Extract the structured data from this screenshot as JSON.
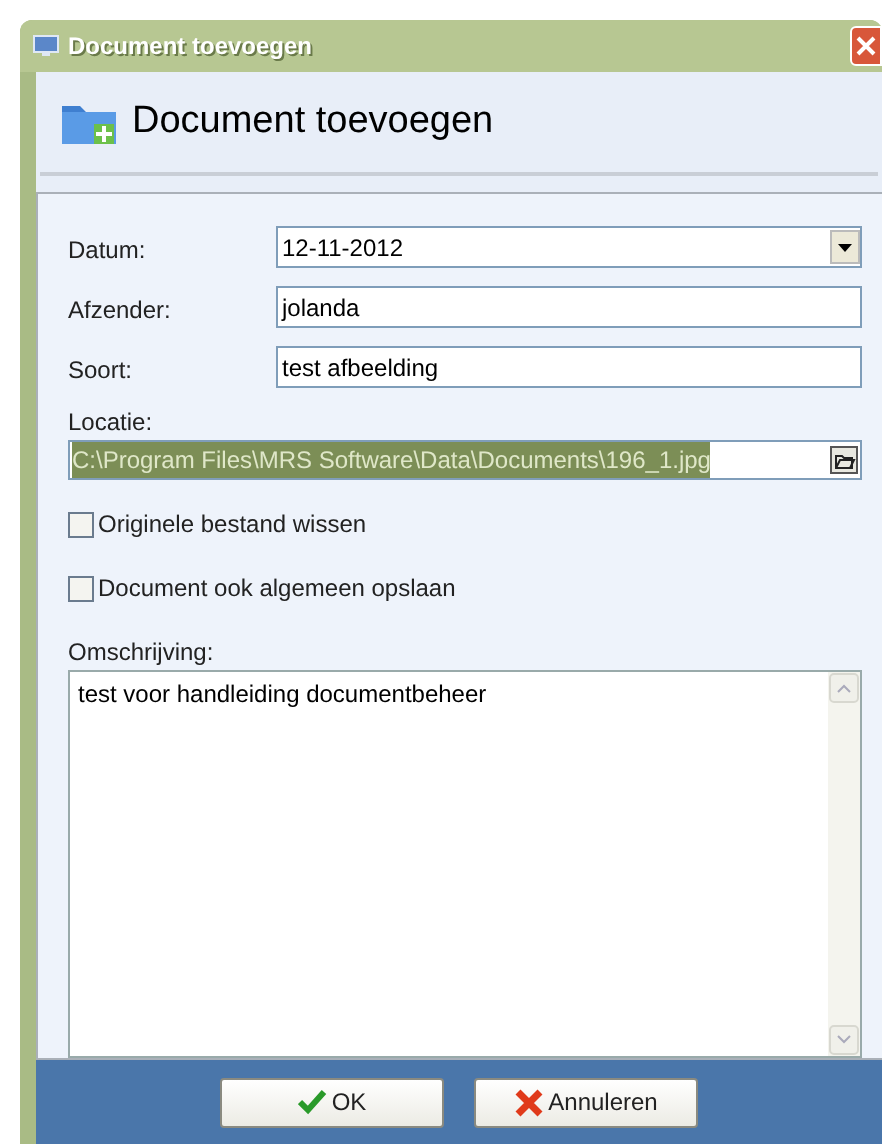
{
  "window": {
    "title": "Document toevoegen"
  },
  "header": {
    "title": "Document toevoegen"
  },
  "fields": [
    {
      "kind": "dropdown",
      "label": "Datum:",
      "value": "12-11-2012"
    },
    {
      "kind": "text",
      "label": "Afzender:",
      "value": "jolanda"
    },
    {
      "kind": "text",
      "label": "Soort:",
      "value": "test afbeelding"
    }
  ],
  "location": {
    "label": "Locatie:",
    "value": "C:\\Program Files\\MRS Software\\Data\\Documents\\196_1.jpg",
    "selected": true
  },
  "checkboxes": [
    {
      "label": "Originele bestand wissen",
      "checked": false
    },
    {
      "label": "Document ook algemeen opslaan",
      "checked": false
    }
  ],
  "description": {
    "label": "Omschrijving:",
    "value": "test voor handleiding documentbeheer"
  },
  "buttons": [
    {
      "kind": "ok",
      "label": "OK"
    },
    {
      "kind": "cancel",
      "label": "Annuleren"
    }
  ]
}
